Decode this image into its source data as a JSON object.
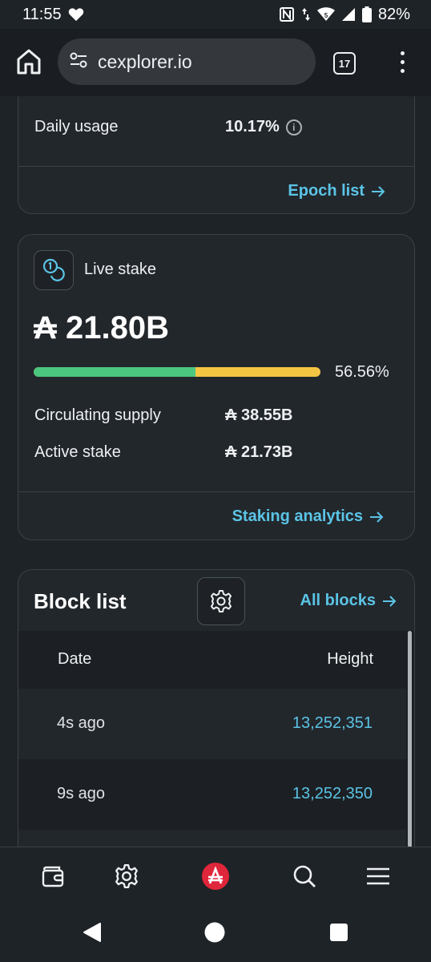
{
  "status_bar": {
    "time": "11:55",
    "battery_pct": "82%",
    "signal_badge": "5"
  },
  "browser": {
    "url": "cexplorer.io",
    "tab_count": "17"
  },
  "epoch_card": {
    "daily_usage_label": "Daily usage",
    "daily_usage_value": "10.17%",
    "link_label": "Epoch list"
  },
  "stake_card": {
    "title": "Live stake",
    "amount": "₳ 21.80B",
    "progress_pct_label": "56.56%",
    "progress_value": 0.5656,
    "circulating_label": "Circulating supply",
    "circulating_value": "₳ 38.55B",
    "active_label": "Active stake",
    "active_value": "₳ 21.73B",
    "link_label": "Staking analytics"
  },
  "block_card": {
    "title": "Block list",
    "link_label": "All blocks",
    "columns": [
      "Date",
      "Height"
    ],
    "rows": [
      {
        "date": "4s ago",
        "height": "13,252,351"
      },
      {
        "date": "9s ago",
        "height": "13,252,350"
      }
    ]
  },
  "colors": {
    "accent": "#5bc4e6",
    "bar_green": "#4cc77f",
    "bar_yellow": "#f4c542",
    "brand_red": "#e0263a"
  }
}
